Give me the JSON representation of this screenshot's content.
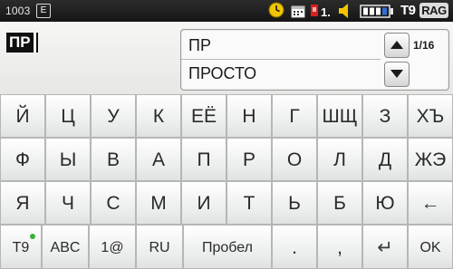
{
  "statusbar": {
    "number": "1003",
    "badge_e": "E",
    "sim_label": "1.",
    "t9": "T9",
    "mode": "RAG",
    "icons": [
      "alarm-icon",
      "calendar-icon",
      "sim-card-icon",
      "speaker-icon",
      "battery-icon"
    ]
  },
  "input": {
    "text": "ПР"
  },
  "suggestions": {
    "items": [
      "ПР",
      "ПРОСТО"
    ],
    "page": "1/16"
  },
  "keyboard": {
    "rows": [
      [
        "Й",
        "Ц",
        "У",
        "К",
        "ЕЁ",
        "Н",
        "Г",
        "ШЩ",
        "З",
        "ХЪ"
      ],
      [
        "Ф",
        "Ы",
        "В",
        "А",
        "П",
        "Р",
        "О",
        "Л",
        "Д",
        "ЖЭ"
      ],
      [
        "Я",
        "Ч",
        "С",
        "М",
        "И",
        "Т",
        "Ь",
        "Б",
        "Ю",
        "←"
      ],
      [
        "T9",
        "ABC",
        "1@",
        "RU",
        "Пробел",
        ".",
        ",",
        "↵",
        "OK"
      ]
    ]
  },
  "colors": {
    "statusbar": "#151515",
    "key_face": "#eaedeb",
    "key_border": "#b4b7b4",
    "keyboard_bg": "#bfc2bf",
    "t9_active_dot": "#3cb03c"
  }
}
